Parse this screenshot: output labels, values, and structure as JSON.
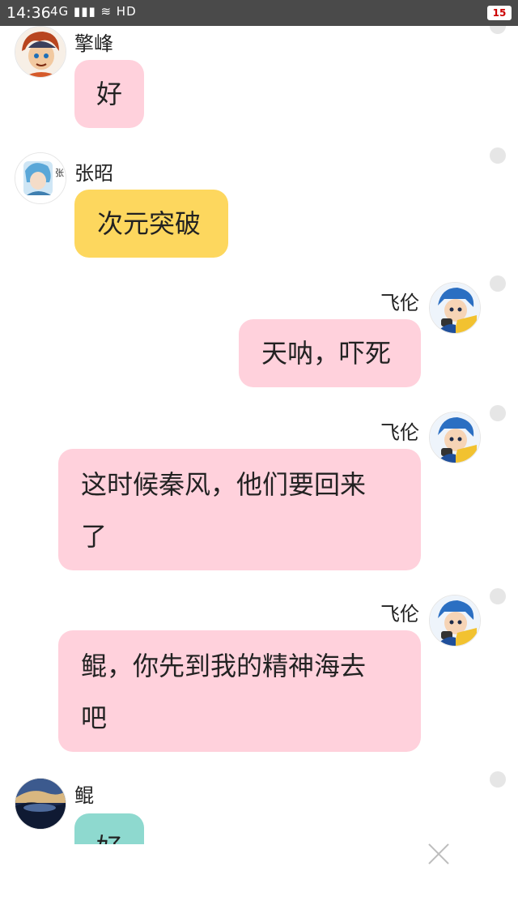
{
  "status": {
    "time": "14:36",
    "icons": "4G ▮▮▮ ≋ HD",
    "battery": "15"
  },
  "messages": [
    {
      "sender": "擎峰",
      "text": "好"
    },
    {
      "sender": "张昭",
      "text": "次元突破",
      "avatar_text": "张"
    },
    {
      "sender": "飞伦",
      "text": "天呐，吓死"
    },
    {
      "sender": "飞伦",
      "text_lines": [
        "这时候秦风，他们要回来",
        "了"
      ]
    },
    {
      "sender": "飞伦",
      "text_lines": [
        "鲲，你先到我的精神海去",
        "吧"
      ]
    },
    {
      "sender": "鲲",
      "text": "好"
    }
  ],
  "colors": {
    "pink": "#ffd1dc",
    "yellow": "#fdd75e",
    "teal": "#8ed9cf"
  }
}
